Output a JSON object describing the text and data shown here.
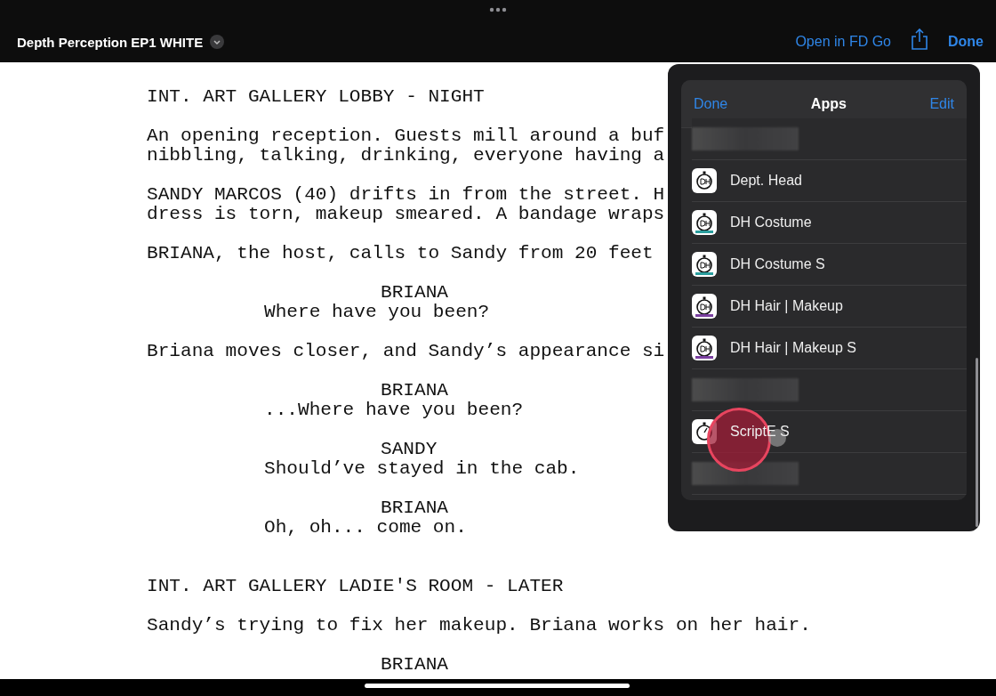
{
  "top_bar": {
    "title": "Depth Perception EP1 WHITE",
    "open_link": "Open in FD Go",
    "done": "Done"
  },
  "script": {
    "blocks": [
      {
        "kind": "heading",
        "lines": [
          "INT. ART GALLERY LOBBY - NIGHT"
        ]
      },
      {
        "kind": "action",
        "lines": [
          "An opening reception. Guests mill around a buf",
          "nibbling, talking, drinking, everyone having a"
        ]
      },
      {
        "kind": "action",
        "lines": [
          "SANDY MARCOS (40) drifts in from the street. H",
          "dress is torn, makeup smeared. A bandage wraps"
        ]
      },
      {
        "kind": "action",
        "lines": [
          "BRIANA, the host, calls to Sandy from 20 feet"
        ]
      },
      {
        "kind": "dialogue",
        "character": "BRIANA",
        "lines": [
          "Where have you been?"
        ]
      },
      {
        "kind": "action",
        "lines": [
          "Briana moves closer, and Sandy’s appearance si"
        ]
      },
      {
        "kind": "dialogue",
        "character": "BRIANA",
        "lines": [
          "...Where have you been?"
        ]
      },
      {
        "kind": "dialogue",
        "character": "SANDY",
        "lines": [
          "Should’ve stayed in the cab."
        ]
      },
      {
        "kind": "dialogue",
        "character": "BRIANA",
        "lines": [
          "Oh, oh... come on."
        ]
      },
      {
        "kind": "heading",
        "lines": [
          "INT. ART GALLERY LADIE'S ROOM - LATER"
        ]
      },
      {
        "kind": "action",
        "lines": [
          "Sandy’s trying to fix her makeup. Briana works on her hair."
        ]
      },
      {
        "kind": "dialogue",
        "character": "BRIANA"
      }
    ]
  },
  "apps_popover": {
    "done": "Done",
    "title": "Apps",
    "edit": "Edit",
    "rows": [
      {
        "kind": "redacted"
      },
      {
        "kind": "app",
        "label": "Dept. Head"
      },
      {
        "kind": "app",
        "label": "DH Costume"
      },
      {
        "kind": "app",
        "label": "DH Costume S"
      },
      {
        "kind": "app",
        "label": "DH Hair | Makeup"
      },
      {
        "kind": "app",
        "label": "DH Hair | Makeup S"
      },
      {
        "kind": "redacted"
      },
      {
        "kind": "app",
        "label": "ScriptE S"
      },
      {
        "kind": "redacted"
      }
    ]
  }
}
